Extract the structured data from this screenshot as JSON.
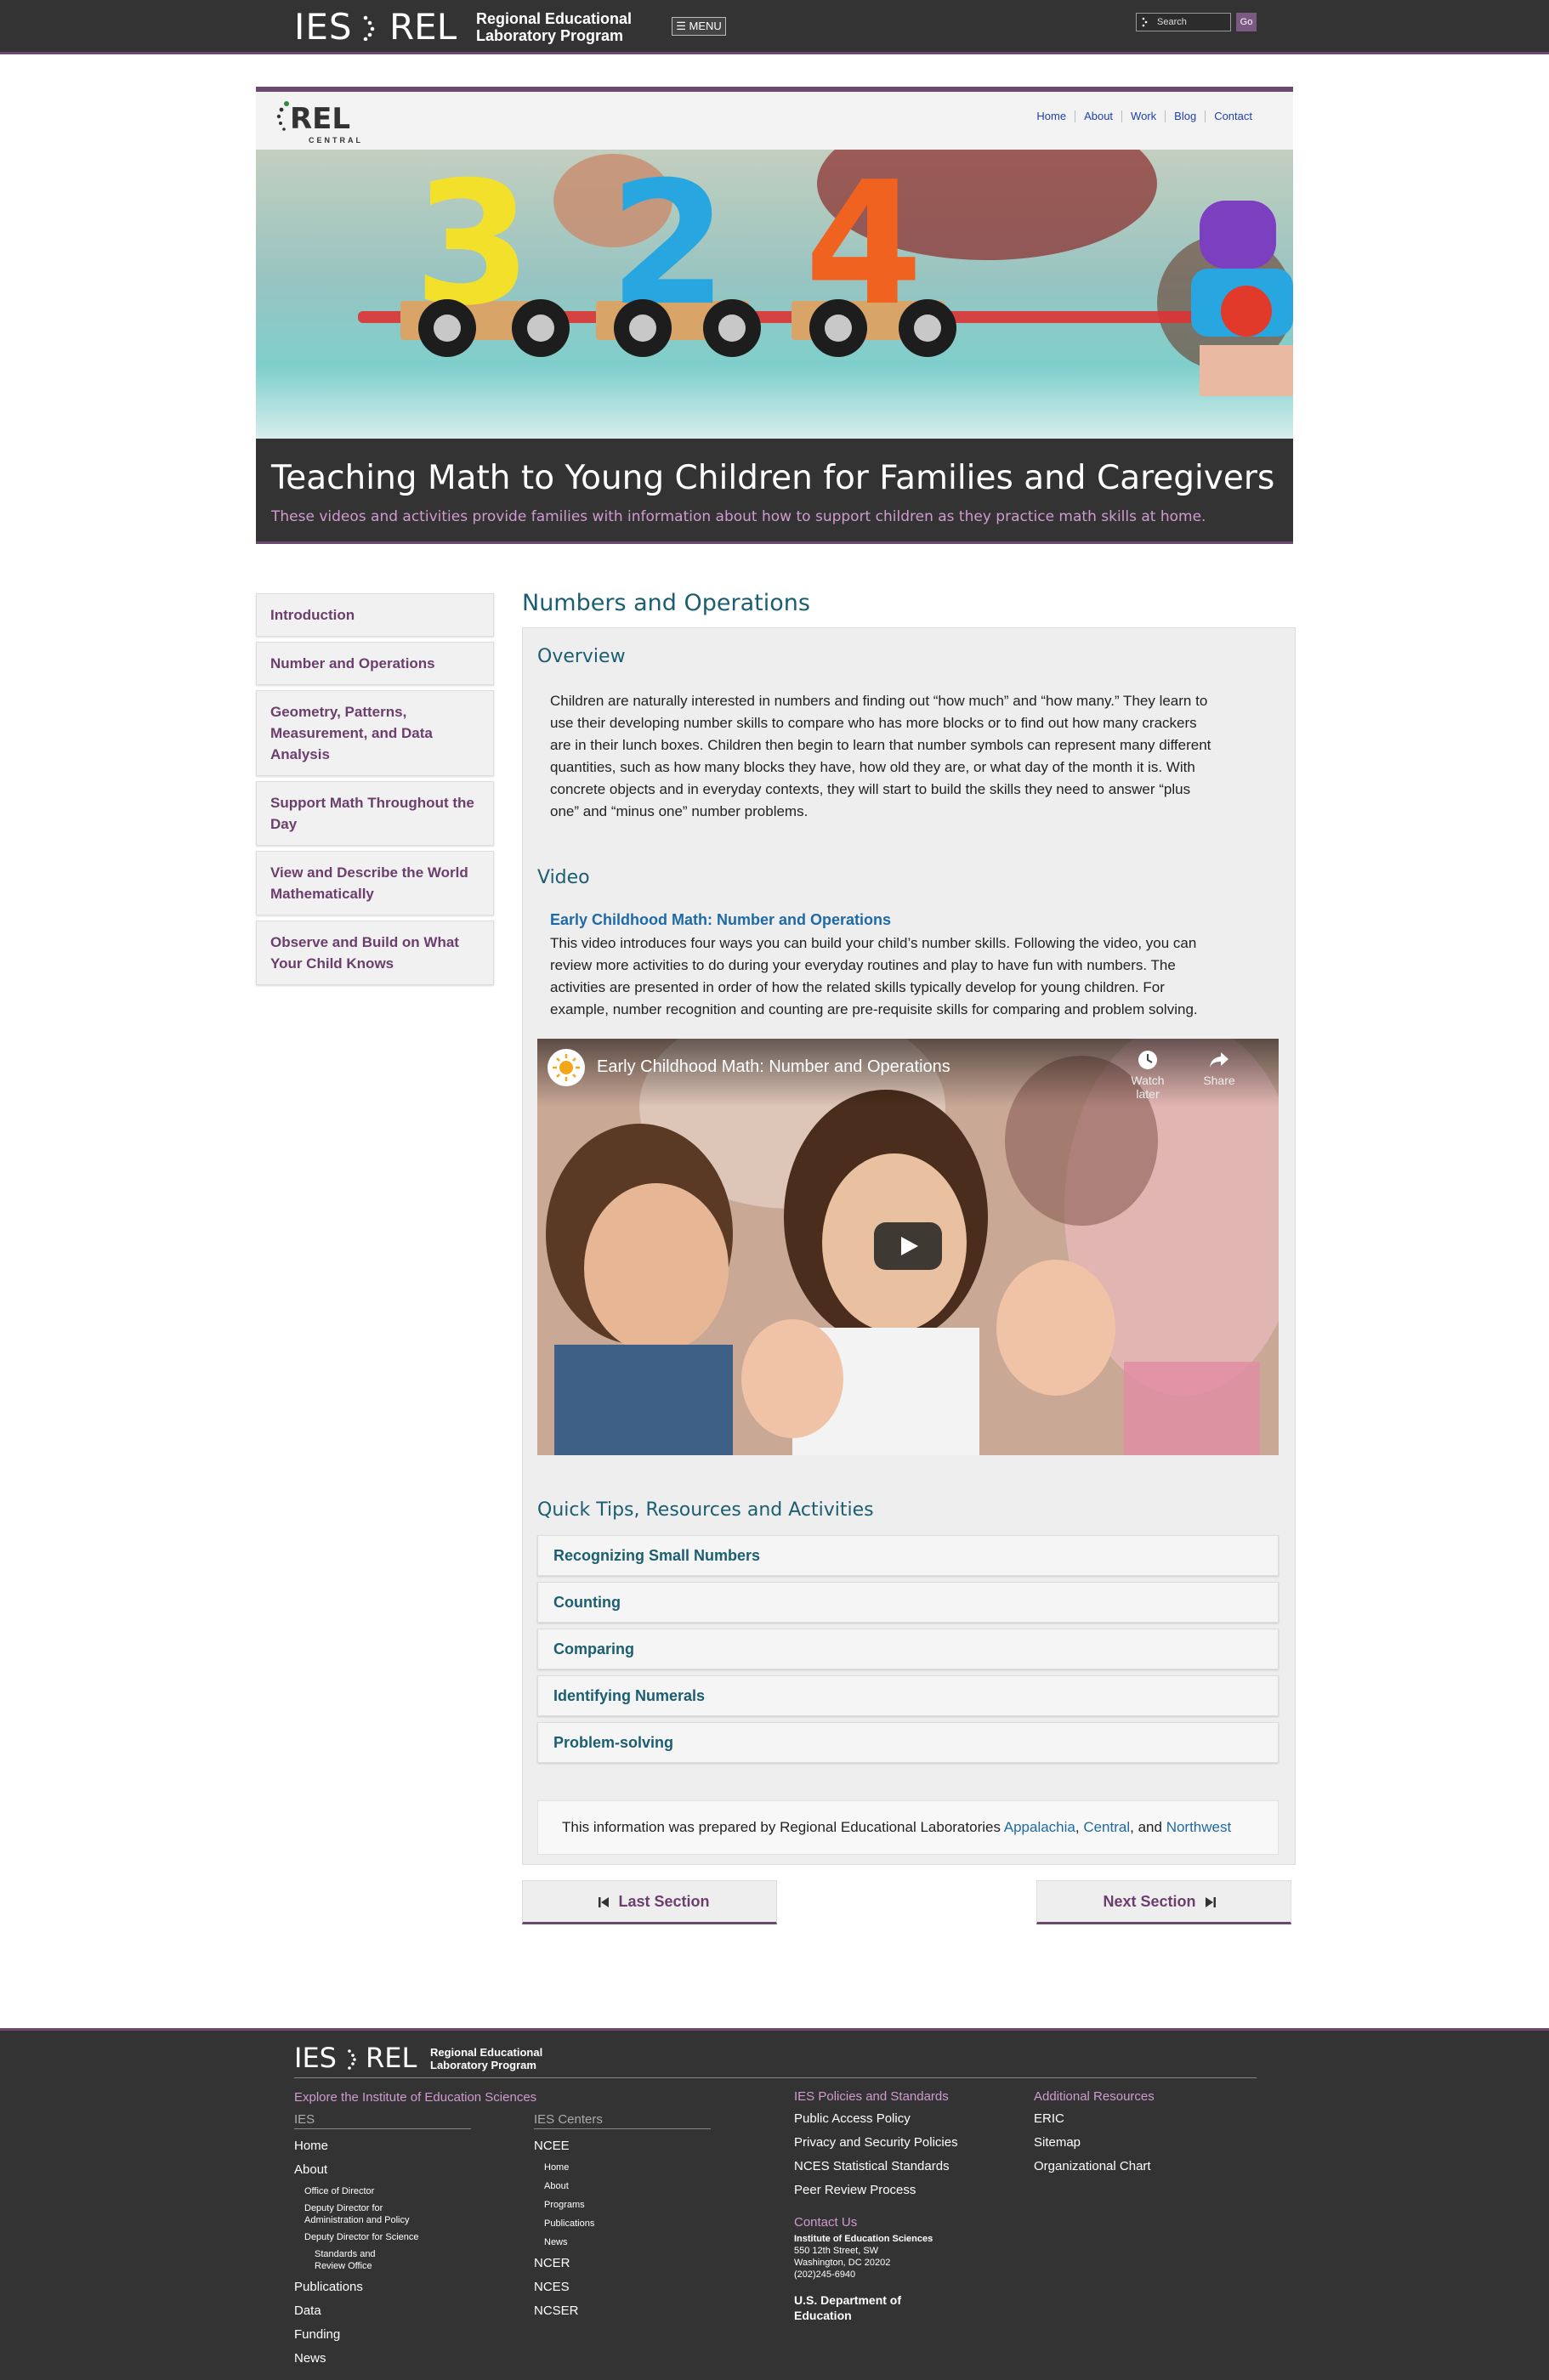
{
  "topbar": {
    "ies": "IES",
    "rel": "REL",
    "program_line1": "Regional Educational",
    "program_line2": "Laboratory Program",
    "menu_label": "☰ MENU",
    "search_placeholder": "Search",
    "go_label": "Go"
  },
  "site_header": {
    "logo_text": "REL",
    "logo_sub": "CENTRAL",
    "nav": [
      "Home",
      "About",
      "Work",
      "Blog",
      "Contact"
    ]
  },
  "hero": {
    "numbers": [
      "3",
      "2",
      "4"
    ],
    "title": "Teaching Math to Young Children for Families and Caregivers",
    "subtitle": "These videos and activities provide families with information about how to support children as they practice math skills at home."
  },
  "sidebar": {
    "items": [
      "Introduction",
      "Number and Operations",
      "Geometry, Patterns, Measurement, and Data Analysis",
      "Support Math Throughout the Day",
      "View and Describe the World Mathematically",
      "Observe and Build on What Your Child Knows"
    ]
  },
  "main": {
    "title": "Numbers and Operations",
    "overview_heading": "Overview",
    "overview_lines": [
      "Children are naturally interested in numbers and finding out “how much” and “how many.” They learn to",
      "use their developing number skills to compare who has more blocks or to find out how many crackers",
      "are in their lunch boxes. Children then begin to learn that number symbols can represent many different",
      "quantities, such as how many blocks they have, how old they are, or what day of the month it is. With",
      "concrete objects and in everyday contexts, they will start to build the skills they need to answer “plus",
      "one” and “minus one” number problems."
    ],
    "video_heading": "Video",
    "video_link": "Early Childhood Math: Number and Operations",
    "video_lines": [
      "This video introduces four ways you can build your child’s number skills. Following the video, you can",
      "review more activities to do during your everyday routines and play to have fun with numbers. The",
      "activities are presented in order of how the related skills typically develop for young children. For",
      "example, number recognition and counting are pre-requisite skills for comparing and problem solving."
    ],
    "video_player": {
      "title": "Early Childhood Math: Number and Operations",
      "watch_later": "Watch later",
      "share": "Share"
    },
    "tips_heading": "Quick Tips, Resources and Activities",
    "tips": [
      "Recognizing Small Numbers",
      "Counting",
      "Comparing",
      "Identifying Numerals",
      "Problem-solving"
    ],
    "prepared": {
      "prefix": "This information was prepared by Regional Educational Laboratories ",
      "link1": "Appalachia",
      "sep1": ", ",
      "link2": "Central",
      "sep2": ", and ",
      "link3": "Northwest"
    },
    "last_section": "Last Section",
    "next_section": "Next Section"
  },
  "footer": {
    "ies": "IES",
    "rel": "REL",
    "program_line1": "Regional Educational",
    "program_line2": "Laboratory Program",
    "explore": "Explore the Institute of Education Sciences",
    "col_ies": {
      "heading": "IES",
      "home": "Home",
      "about": "About",
      "office": "Office of Director",
      "deputy_admin_1": "Deputy Director for",
      "deputy_admin_2": "Administration and Policy",
      "deputy_sci": "Deputy Director for Science",
      "standards_1": "Standards and",
      "standards_2": "Review Office",
      "publications": "Publications",
      "data": "Data",
      "funding": "Funding",
      "news": "News"
    },
    "col_centers": {
      "heading": "IES Centers",
      "ncee": "NCEE",
      "sub": [
        "Home",
        "About",
        "Programs",
        "Publications",
        "News"
      ],
      "ncer": "NCER",
      "nces": "NCES",
      "ncser": "NCSER"
    },
    "col_policies": {
      "heading": "IES Policies and Standards",
      "items": [
        "Public Access Policy",
        "Privacy and Security Policies",
        "NCES Statistical Standards",
        "Peer Review Process"
      ],
      "contact_heading": "Contact Us",
      "org": "Institute of Education Sciences",
      "addr1": "550 12th Street, SW",
      "addr2": "Washington, DC 20202",
      "phone": "(202)245-6940",
      "dept1": "U.S. Department of",
      "dept2": "Education"
    },
    "col_additional": {
      "heading": "Additional Resources",
      "items": [
        "ERIC",
        "Sitemap",
        "Organizational Chart"
      ]
    }
  }
}
